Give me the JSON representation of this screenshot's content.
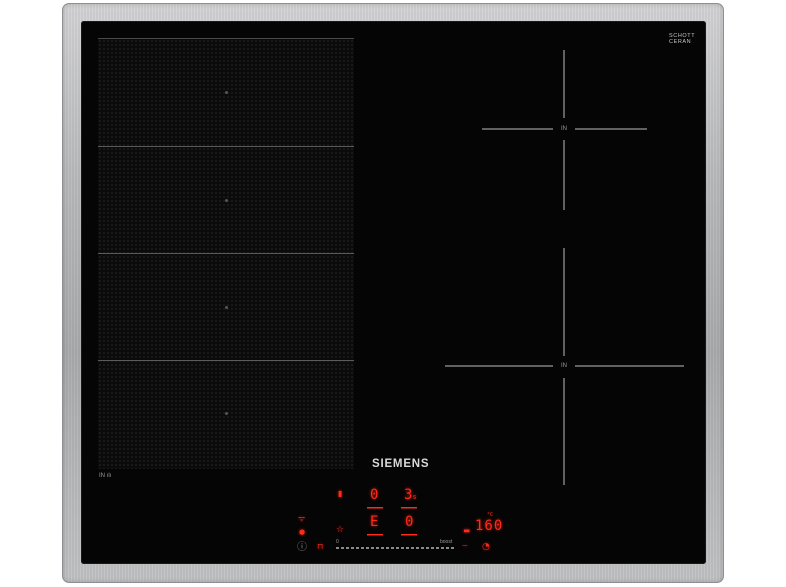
{
  "product": {
    "brand": "SIEMENS",
    "glass_brand_line1": "SCHOTT",
    "glass_brand_line2": "CERAN",
    "glass_brand_line3": "",
    "model_small": "",
    "flex_zone_label": "IN",
    "flex_zone_symbol": "ılı",
    "burner_top_label": "IN",
    "burner_bottom_label": "IN"
  },
  "controls": {
    "display_left_top": "0",
    "display_left_mid": "E",
    "display_right_top": "3",
    "display_right_top_sub": "s",
    "display_right_mid": "0",
    "temperature_display": "160",
    "temperature_unit": "°C",
    "slider_start": "0",
    "slider_end": "boost",
    "icons": {
      "wifi": "wifi-icon",
      "favourite": "star-icon",
      "info": "info-icon",
      "lock": "lock-icon",
      "frying_sensor": "pan-sensor-icon",
      "timer": "timer-icon",
      "power": "power-icon"
    }
  }
}
